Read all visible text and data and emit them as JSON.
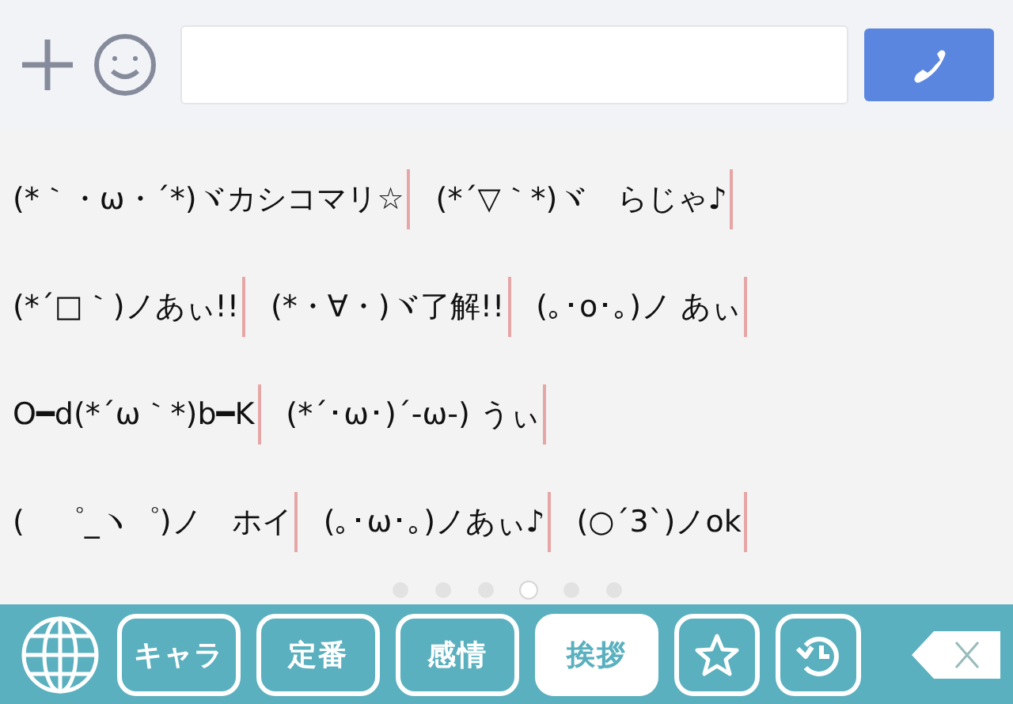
{
  "kaomoji_rows": [
    [
      "(*｀・ω・´*)ヾカシコマリ☆",
      "(*´▽｀*)ヾ　らじゃ♪"
    ],
    [
      "(*´□｀)ノあぃ!!",
      "(*・∀・)ヾ了解!!",
      "(｡･o･｡)ノ あぃ"
    ],
    [
      "O━d(*´ω｀*)b━K",
      "(*´･ω･)´-ω-) うぃ"
    ],
    [
      "(　゜_ヽ゜)ノ　ホイ",
      "(｡･ω･｡)ノあぃ♪",
      "(○´3`)ノok"
    ]
  ],
  "pages": [
    {
      "selected": false
    },
    {
      "selected": false
    },
    {
      "selected": false
    },
    {
      "selected": true
    },
    {
      "selected": false
    },
    {
      "selected": false
    }
  ],
  "tabs": [
    {
      "kind": "globe",
      "selected": false
    },
    {
      "kind": "text",
      "label": "キャラ",
      "selected": false
    },
    {
      "kind": "text",
      "label": "定番",
      "selected": false
    },
    {
      "kind": "text",
      "label": "感情",
      "selected": false
    },
    {
      "kind": "text",
      "label": "挨拶",
      "selected": true
    },
    {
      "kind": "star",
      "selected": false
    },
    {
      "kind": "history",
      "selected": false
    },
    {
      "kind": "backspace",
      "selected": false
    }
  ]
}
